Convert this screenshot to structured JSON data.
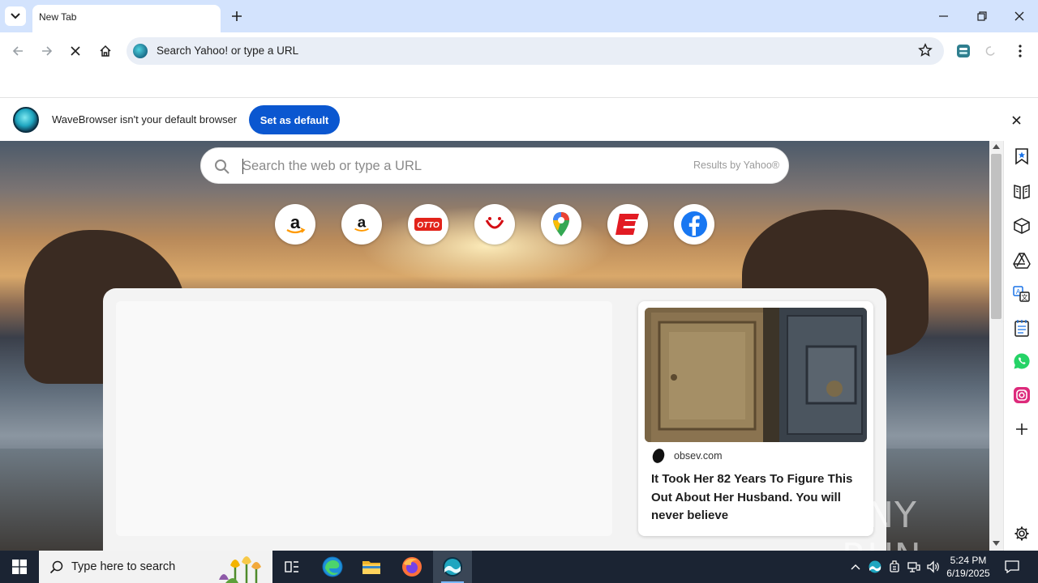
{
  "browser": {
    "tab_title": "New Tab",
    "omnibox_text": "Search Yahoo! or type a URL"
  },
  "infobar": {
    "message": "WaveBrowser isn't your default browser",
    "button_label": "Set as default"
  },
  "newtab": {
    "search_placeholder": "Search the web or type a URL",
    "results_by": "Results by Yahoo®",
    "shortcuts": [
      "amazon",
      "amazon",
      "otto",
      "tui",
      "google-maps",
      "espn",
      "facebook"
    ]
  },
  "feed": {
    "card": {
      "source": "obsev.com",
      "title": "It Took Her 82 Years To Figure This Out About Her Husband. You will never believe"
    }
  },
  "watermark": "ANY RUN",
  "taskbar": {
    "search_placeholder": "Type here to search",
    "time": "5:24 PM",
    "date": "6/19/2025"
  },
  "colors": {
    "accent": "#0b57d0",
    "tabstrip": "#d3e3fd",
    "taskbar": "#1b2433"
  }
}
